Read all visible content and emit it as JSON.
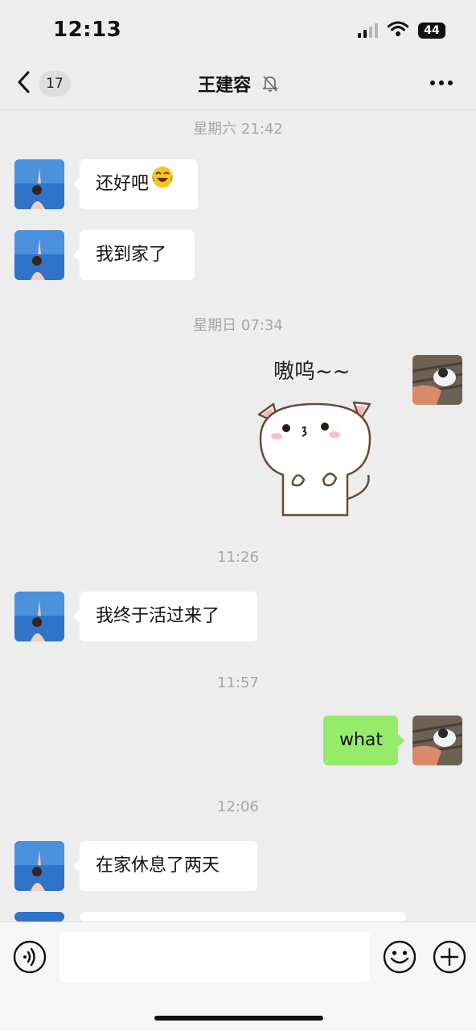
{
  "status": {
    "time": "12:13",
    "battery": "44"
  },
  "nav": {
    "unread_count": "17",
    "title": "王建容"
  },
  "timestamps": [
    "星期六 21:42",
    "星期日 07:34",
    "11:26",
    "11:57",
    "12:06"
  ],
  "messages": [
    {
      "side": "left",
      "text": "还好吧"
    },
    {
      "side": "left",
      "text": "我到家了"
    },
    {
      "side": "right",
      "type": "sticker",
      "text": "嗷呜~~"
    },
    {
      "side": "left",
      "text": "我终于活过来了"
    },
    {
      "side": "right",
      "text": "what"
    },
    {
      "side": "left",
      "text": "在家休息了两天"
    }
  ],
  "input": {
    "placeholder": ""
  },
  "colors": {
    "background": "#ededed",
    "my_bubble": "#95ec69",
    "their_bubble": "#ffffff"
  }
}
